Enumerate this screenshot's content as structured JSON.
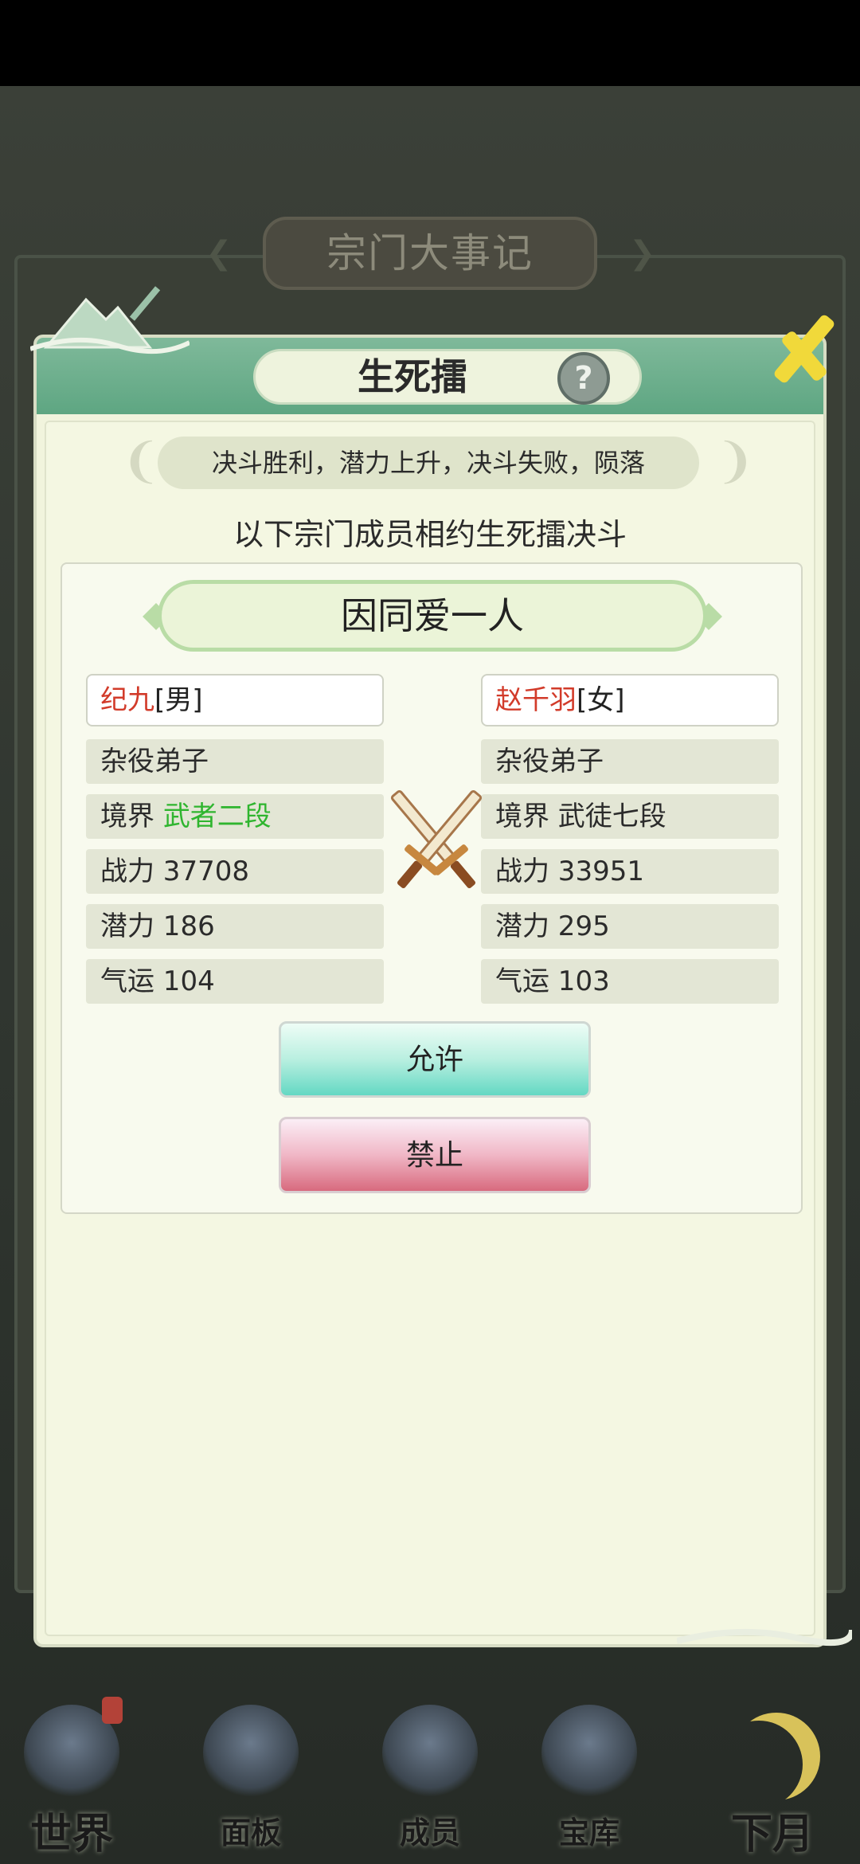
{
  "background": {
    "title": "宗门大事记"
  },
  "modal": {
    "title": "生死擂",
    "help_icon": "?",
    "rule": "决斗胜利，潜力上升，决斗失败，陨落",
    "subtitle": "以下宗门成员相约生死擂决斗",
    "reason": "因同爱一人",
    "left": {
      "name": "纪九",
      "gender": "[男]",
      "role": "杂役弟子",
      "realm_label": "境界",
      "realm_value": "武者二段",
      "power": "战力 37708",
      "potential": "潜力 186",
      "luck": "气运 104"
    },
    "right": {
      "name": "赵千羽",
      "gender": "[女]",
      "role": "杂役弟子",
      "realm": "境界 武徒七段",
      "power": "战力 33951",
      "potential": "潜力 295",
      "luck": "气运 103"
    },
    "allow_label": "允许",
    "deny_label": "禁止"
  },
  "nav": {
    "items": [
      "世界",
      "面板",
      "成员",
      "宝库",
      "下月"
    ]
  },
  "colors": {
    "header_green": "#5ea682",
    "name_red": "#d23b2a",
    "realm_green": "#2fb52f",
    "close_yellow": "#f1d93a"
  },
  "icons": {
    "close": "close-icon",
    "help": "question-icon",
    "duel": "crossed-swords-icon"
  }
}
